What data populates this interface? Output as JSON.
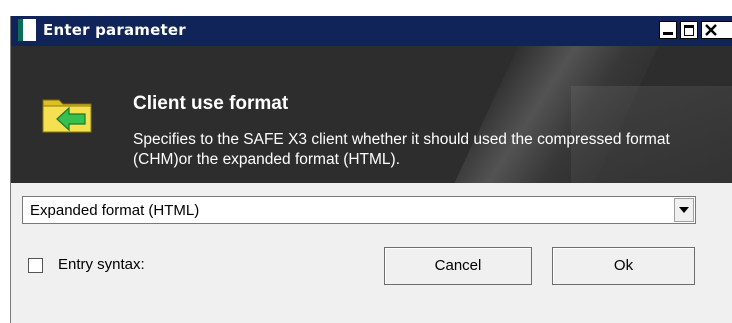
{
  "window": {
    "title": "Enter parameter",
    "controls": [
      "minimize-icon",
      "maximize-icon",
      "close-icon"
    ]
  },
  "header": {
    "icon": "folder-arrow-icon",
    "title": "Client use format",
    "description": "Specifies to the SAFE X3 client whether it should used the compressed format (CHM)or the expanded format (HTML)."
  },
  "form": {
    "format_select": {
      "value": "Expanded format (HTML)"
    },
    "entry_syntax": {
      "label": "Entry syntax:",
      "checked": false
    },
    "cancel_label": "Cancel",
    "ok_label": "Ok"
  }
}
